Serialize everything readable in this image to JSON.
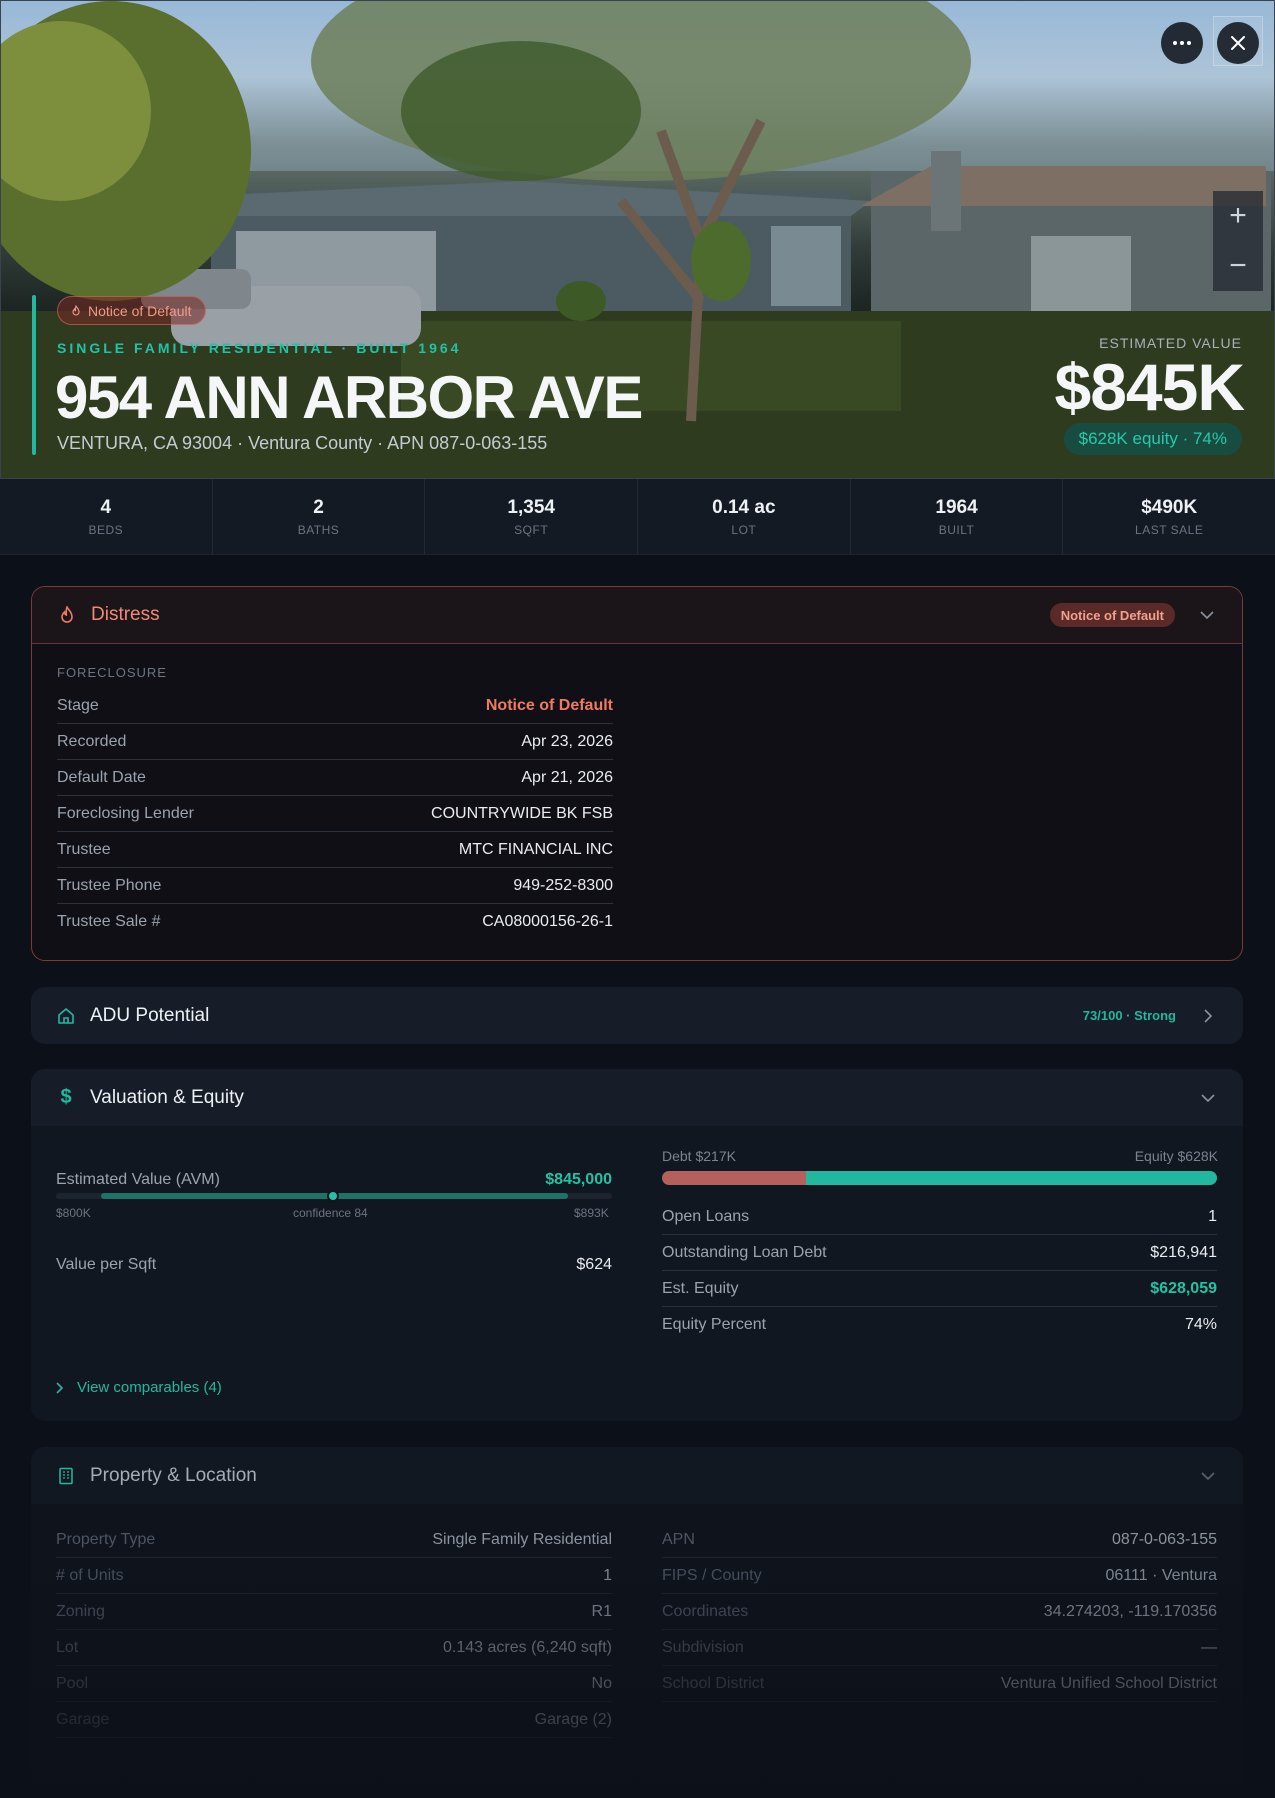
{
  "hero": {
    "badge": "Notice of Default",
    "kicker": "SINGLE FAMILY RESIDENTIAL · BUILT 1964",
    "address": "954 ANN ARBOR AVE",
    "subtitle": "VENTURA, CA 93004 · Ventura County · APN 087-0-063-155",
    "est_label": "ESTIMATED VALUE",
    "est_value": "$845K",
    "equity_pill": "$628K equity · 74%",
    "zoom_in": "+",
    "zoom_out": "−"
  },
  "stats": [
    {
      "value": "4",
      "label": "BEDS"
    },
    {
      "value": "2",
      "label": "BATHS"
    },
    {
      "value": "1,354",
      "label": "SQFT"
    },
    {
      "value": "0.14 ac",
      "label": "LOT"
    },
    {
      "value": "1964",
      "label": "BUILT"
    },
    {
      "value": "$490K",
      "label": "LAST SALE"
    }
  ],
  "distress": {
    "title": "Distress",
    "pill": "Notice of Default",
    "section": "FORECLOSURE",
    "rows": [
      {
        "k": "Stage",
        "v": "Notice of Default"
      },
      {
        "k": "Recorded",
        "v": "Apr 23, 2026"
      },
      {
        "k": "Default Date",
        "v": "Apr 21, 2026"
      },
      {
        "k": "Foreclosing Lender",
        "v": "COUNTRYWIDE BK FSB"
      },
      {
        "k": "Trustee",
        "v": "MTC FINANCIAL INC"
      },
      {
        "k": "Trustee Phone",
        "v": "949-252-8300"
      },
      {
        "k": "Trustee Sale #",
        "v": "CA08000156-26-1"
      }
    ]
  },
  "adu": {
    "title": "ADU Potential",
    "score": "73/100 · Strong"
  },
  "valuation": {
    "title": "Valuation & Equity",
    "avm_label": "Estimated Value (AVM)",
    "avm_value": "$845,000",
    "range_low": "$800K",
    "range_high": "$893K",
    "confidence": "confidence 84",
    "vps_label": "Value per Sqft",
    "vps_value": "$624",
    "debt_label": "Debt $217K",
    "equity_label": "Equity $628K",
    "equity_fraction": 0.74,
    "rows": [
      {
        "k": "Open Loans",
        "v": "1"
      },
      {
        "k": "Outstanding Loan Debt",
        "v": "$216,941"
      },
      {
        "k": "Est. Equity",
        "v": "$628,059"
      },
      {
        "k": "Equity Percent",
        "v": "74%"
      }
    ],
    "comps_link": "View comparables (4)"
  },
  "property": {
    "title": "Property & Location",
    "left": [
      {
        "k": "Property Type",
        "v": "Single Family Residential"
      },
      {
        "k": "# of Units",
        "v": "1"
      },
      {
        "k": "Zoning",
        "v": "R1"
      },
      {
        "k": "Lot",
        "v": "0.143 acres (6,240 sqft)"
      },
      {
        "k": "Pool",
        "v": "No"
      },
      {
        "k": "Garage",
        "v": "Garage (2)"
      }
    ],
    "right": [
      {
        "k": "APN",
        "v": "087-0-063-155"
      },
      {
        "k": "FIPS / County",
        "v": "06111 · Ventura"
      },
      {
        "k": "Coordinates",
        "v": "34.274203, -119.170356"
      },
      {
        "k": "Subdivision",
        "v": "—"
      },
      {
        "k": "School District",
        "v": "Ventura Unified School District"
      }
    ]
  },
  "colors": {
    "accent_teal": "#22b8a0",
    "distress_red": "#ef7a62",
    "background": "#0c1018"
  }
}
